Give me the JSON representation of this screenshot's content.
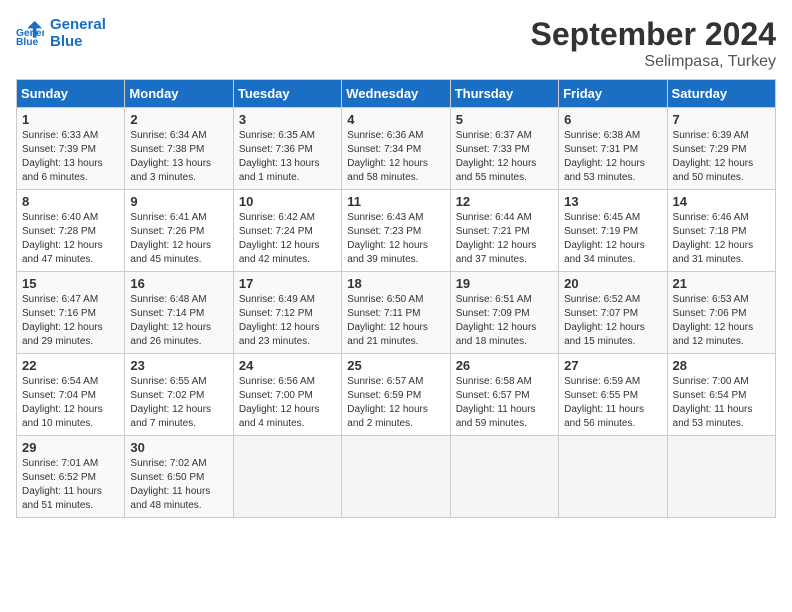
{
  "header": {
    "logo_line1": "General",
    "logo_line2": "Blue",
    "month": "September 2024",
    "location": "Selimpasa, Turkey"
  },
  "weekdays": [
    "Sunday",
    "Monday",
    "Tuesday",
    "Wednesday",
    "Thursday",
    "Friday",
    "Saturday"
  ],
  "weeks": [
    [
      {
        "day": "1",
        "rise": "6:33 AM",
        "set": "7:39 PM",
        "daylight": "13 hours and 6 minutes."
      },
      {
        "day": "2",
        "rise": "6:34 AM",
        "set": "7:38 PM",
        "daylight": "13 hours and 3 minutes."
      },
      {
        "day": "3",
        "rise": "6:35 AM",
        "set": "7:36 PM",
        "daylight": "13 hours and 1 minute."
      },
      {
        "day": "4",
        "rise": "6:36 AM",
        "set": "7:34 PM",
        "daylight": "12 hours and 58 minutes."
      },
      {
        "day": "5",
        "rise": "6:37 AM",
        "set": "7:33 PM",
        "daylight": "12 hours and 55 minutes."
      },
      {
        "day": "6",
        "rise": "6:38 AM",
        "set": "7:31 PM",
        "daylight": "12 hours and 53 minutes."
      },
      {
        "day": "7",
        "rise": "6:39 AM",
        "set": "7:29 PM",
        "daylight": "12 hours and 50 minutes."
      }
    ],
    [
      {
        "day": "8",
        "rise": "6:40 AM",
        "set": "7:28 PM",
        "daylight": "12 hours and 47 minutes."
      },
      {
        "day": "9",
        "rise": "6:41 AM",
        "set": "7:26 PM",
        "daylight": "12 hours and 45 minutes."
      },
      {
        "day": "10",
        "rise": "6:42 AM",
        "set": "7:24 PM",
        "daylight": "12 hours and 42 minutes."
      },
      {
        "day": "11",
        "rise": "6:43 AM",
        "set": "7:23 PM",
        "daylight": "12 hours and 39 minutes."
      },
      {
        "day": "12",
        "rise": "6:44 AM",
        "set": "7:21 PM",
        "daylight": "12 hours and 37 minutes."
      },
      {
        "day": "13",
        "rise": "6:45 AM",
        "set": "7:19 PM",
        "daylight": "12 hours and 34 minutes."
      },
      {
        "day": "14",
        "rise": "6:46 AM",
        "set": "7:18 PM",
        "daylight": "12 hours and 31 minutes."
      }
    ],
    [
      {
        "day": "15",
        "rise": "6:47 AM",
        "set": "7:16 PM",
        "daylight": "12 hours and 29 minutes."
      },
      {
        "day": "16",
        "rise": "6:48 AM",
        "set": "7:14 PM",
        "daylight": "12 hours and 26 minutes."
      },
      {
        "day": "17",
        "rise": "6:49 AM",
        "set": "7:12 PM",
        "daylight": "12 hours and 23 minutes."
      },
      {
        "day": "18",
        "rise": "6:50 AM",
        "set": "7:11 PM",
        "daylight": "12 hours and 21 minutes."
      },
      {
        "day": "19",
        "rise": "6:51 AM",
        "set": "7:09 PM",
        "daylight": "12 hours and 18 minutes."
      },
      {
        "day": "20",
        "rise": "6:52 AM",
        "set": "7:07 PM",
        "daylight": "12 hours and 15 minutes."
      },
      {
        "day": "21",
        "rise": "6:53 AM",
        "set": "7:06 PM",
        "daylight": "12 hours and 12 minutes."
      }
    ],
    [
      {
        "day": "22",
        "rise": "6:54 AM",
        "set": "7:04 PM",
        "daylight": "12 hours and 10 minutes."
      },
      {
        "day": "23",
        "rise": "6:55 AM",
        "set": "7:02 PM",
        "daylight": "12 hours and 7 minutes."
      },
      {
        "day": "24",
        "rise": "6:56 AM",
        "set": "7:00 PM",
        "daylight": "12 hours and 4 minutes."
      },
      {
        "day": "25",
        "rise": "6:57 AM",
        "set": "6:59 PM",
        "daylight": "12 hours and 2 minutes."
      },
      {
        "day": "26",
        "rise": "6:58 AM",
        "set": "6:57 PM",
        "daylight": "11 hours and 59 minutes."
      },
      {
        "day": "27",
        "rise": "6:59 AM",
        "set": "6:55 PM",
        "daylight": "11 hours and 56 minutes."
      },
      {
        "day": "28",
        "rise": "7:00 AM",
        "set": "6:54 PM",
        "daylight": "11 hours and 53 minutes."
      }
    ],
    [
      {
        "day": "29",
        "rise": "7:01 AM",
        "set": "6:52 PM",
        "daylight": "11 hours and 51 minutes."
      },
      {
        "day": "30",
        "rise": "7:02 AM",
        "set": "6:50 PM",
        "daylight": "11 hours and 48 minutes."
      },
      null,
      null,
      null,
      null,
      null
    ]
  ]
}
